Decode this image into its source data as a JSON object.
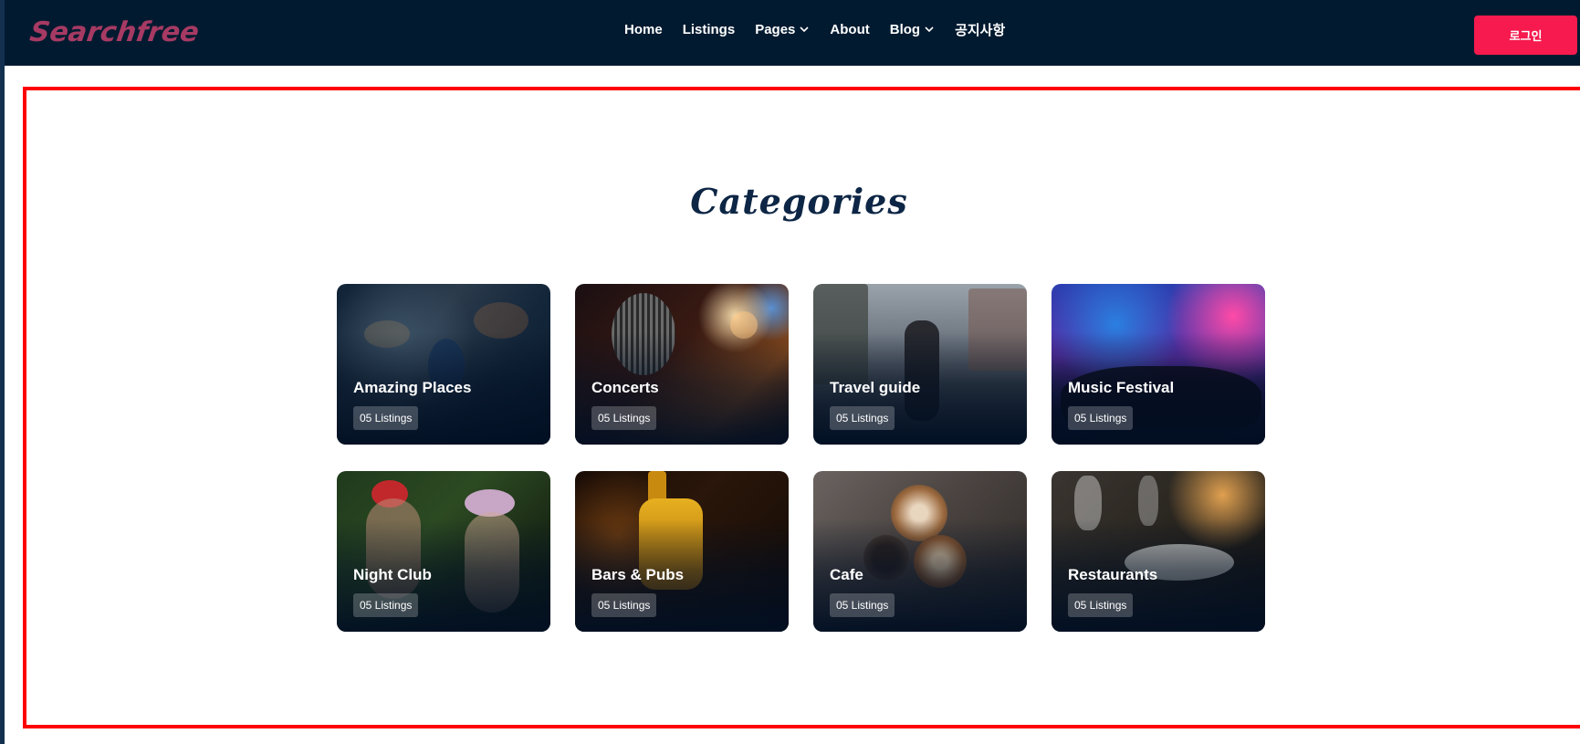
{
  "header": {
    "brand": "Searchfree",
    "nav": [
      {
        "label": "Home",
        "has_dropdown": false
      },
      {
        "label": "Listings",
        "has_dropdown": false
      },
      {
        "label": "Pages",
        "has_dropdown": true
      },
      {
        "label": "About",
        "has_dropdown": false
      },
      {
        "label": "Blog",
        "has_dropdown": true
      },
      {
        "label": "공지사항",
        "has_dropdown": false
      }
    ],
    "login_label": "로그인"
  },
  "colors": {
    "navbar_bg": "#011a30",
    "brand": "#a63a63",
    "accent": "#f61a4e",
    "title": "#0d2645",
    "highlight_frame": "#ff0000"
  },
  "categories_section": {
    "title": "Categories",
    "cards": [
      {
        "title": "Amazing Places",
        "badge": "05 Listings",
        "image": "blurred-city-cyclist-photo"
      },
      {
        "title": "Concerts",
        "badge": "05 Listings",
        "image": "vintage-microphone-bokeh-photo"
      },
      {
        "title": "Travel guide",
        "badge": "05 Listings",
        "image": "city-street-traveler-photo"
      },
      {
        "title": "Music Festival",
        "badge": "05 Listings",
        "image": "concert-crowd-stage-lights-photo"
      },
      {
        "title": "Night Club",
        "badge": "05 Listings",
        "image": "night-club-people-photo"
      },
      {
        "title": "Bars & Pubs",
        "badge": "05 Listings",
        "image": "liquor-bottle-bar-photo"
      },
      {
        "title": "Cafe",
        "badge": "05 Listings",
        "image": "latte-art-cups-photo"
      },
      {
        "title": "Restaurants",
        "badge": "05 Listings",
        "image": "restaurant-table-dining-photo"
      }
    ]
  }
}
